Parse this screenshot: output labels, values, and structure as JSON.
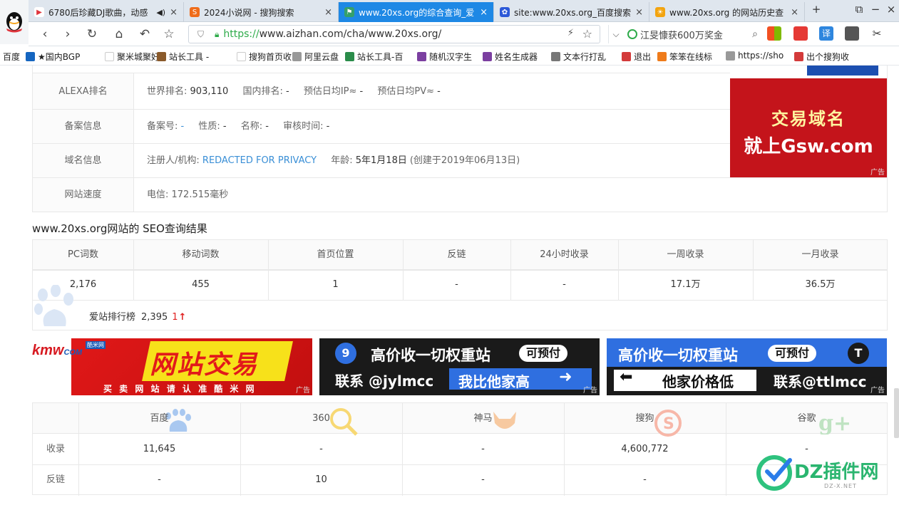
{
  "tabs": [
    {
      "title": "6780后珍藏DJ歌曲，动感",
      "icon_color": "#e0353c",
      "close": "×"
    },
    {
      "title": "2024小说网 - 搜狗搜索",
      "icon_color": "#ef6c1a",
      "close": "×"
    },
    {
      "title": "www.20xs.org的综合查询_爱",
      "icon_color": "#35a06b",
      "close": "×",
      "active": true
    },
    {
      "title": "site:www.20xs.org_百度搜索",
      "icon_color": "#2d59d8",
      "close": "×"
    },
    {
      "title": "www.20xs.org 的网站历史查",
      "icon_color": "#f3a40f",
      "close": "×"
    }
  ],
  "window": {
    "new_tab": "+",
    "restore": "⧉",
    "minimize": "−",
    "close": "×"
  },
  "nav": {
    "back": "‹",
    "forward": "›",
    "reload": "↻",
    "home": "⌂",
    "undo": "↶",
    "favorite": "☆"
  },
  "url": {
    "scheme": "https://",
    "rest": "www.aizhan.com/cha/www.20xs.org/"
  },
  "search": {
    "text": "江旻慷获600万奖金"
  },
  "bookmarks": [
    {
      "label": "百度",
      "color": "#2932e1"
    },
    {
      "label": "★国内BGP",
      "color": "#1565c0"
    },
    {
      "label": "聚米城聚好",
      "color": "#ffffff"
    },
    {
      "label": "站长工具 -",
      "color": "#8a5a2b"
    },
    {
      "label": "搜狗首页收",
      "color": "#ffffff"
    },
    {
      "label": "阿里云盘",
      "color": "#999999"
    },
    {
      "label": "站长工具-百",
      "color": "#2a8c4a"
    },
    {
      "label": "随机汉字生",
      "color": "#7b3fa0"
    },
    {
      "label": "姓名生成器",
      "color": "#7b3fa0"
    },
    {
      "label": "文本行打乱",
      "color": "#777777"
    },
    {
      "label": "退出",
      "color": "#d33a3a"
    },
    {
      "label": "笨笨在线标",
      "color": "#ef7b1a"
    },
    {
      "label": "https://sho",
      "color": "#999999"
    },
    {
      "label": "出个搜狗收",
      "color": "#d33a3a"
    }
  ],
  "info": {
    "alexa": {
      "label": "ALEXA排名",
      "world_label": "世界排名:",
      "world": "903,110",
      "cn_label": "国内排名:",
      "cn": "-",
      "ip_label": "预估日均IP≈",
      "ip": "-",
      "pv_label": "预估日均PV≈",
      "pv": "-"
    },
    "beian": {
      "label": "备案信息",
      "no_label": "备案号:",
      "no": "-",
      "nature_label": "性质:",
      "nature": "-",
      "name_label": "名称:",
      "name": "-",
      "time_label": "审核时间:",
      "time": "-"
    },
    "domain": {
      "label": "域名信息",
      "registrant_label": "注册人/机构:",
      "registrant": "REDACTED FOR PRIVACY",
      "age_label": "年龄:",
      "age": "5年1月18日",
      "created": "(创建于2019年06月13日)"
    },
    "speed": {
      "label": "网站速度",
      "value": "电信: 172.515毫秒"
    }
  },
  "ad_side": {
    "line1": "交易域名",
    "line2": "就上Gsw.com",
    "tag": "广告"
  },
  "seo": {
    "title": "www.20xs.org网站的 SEO查询结果",
    "headers": [
      "PC词数",
      "移动词数",
      "首页位置",
      "反链",
      "24小时收录",
      "一周收录",
      "一月收录"
    ],
    "values": [
      "2,176",
      "455",
      "1",
      "-",
      "-",
      "17.1万",
      "36.5万"
    ],
    "rank_label": "爱站排行榜",
    "rank_value": "2,395",
    "rank_change": "1",
    "rank_arrow": "↑"
  },
  "ads": {
    "kmw_logo": "kmw",
    "kmw_logo2": "COM",
    "kmw_badge": "酷米网",
    "kmw_title": "网站交易",
    "kmw_sub": "买 卖 网 站 请 认 准 酷 米 网",
    "jy_line1": "高价收一切权重站",
    "jy_badge": "可预付",
    "jy_line2a": "联系 @jylmcc",
    "jy_line2b": "我比他家高",
    "tt_line1": "高价收一切权重站",
    "tt_badge": "可预付",
    "tt_line2a": "他家价格低",
    "tt_line2b": "联系@ttlmcc",
    "tag": "广告"
  },
  "engines": {
    "headers": [
      "百度",
      "360",
      "神马",
      "搜狗",
      "谷歌"
    ],
    "row_labels": [
      "收录",
      "反链"
    ],
    "rows": [
      [
        "11,645",
        "-",
        "-",
        "4,600,772",
        "-"
      ],
      [
        "-",
        "10",
        "-",
        "-",
        ""
      ]
    ]
  },
  "watermark": {
    "text": "DZ插件网",
    "sub": "DZ-X.NET"
  }
}
